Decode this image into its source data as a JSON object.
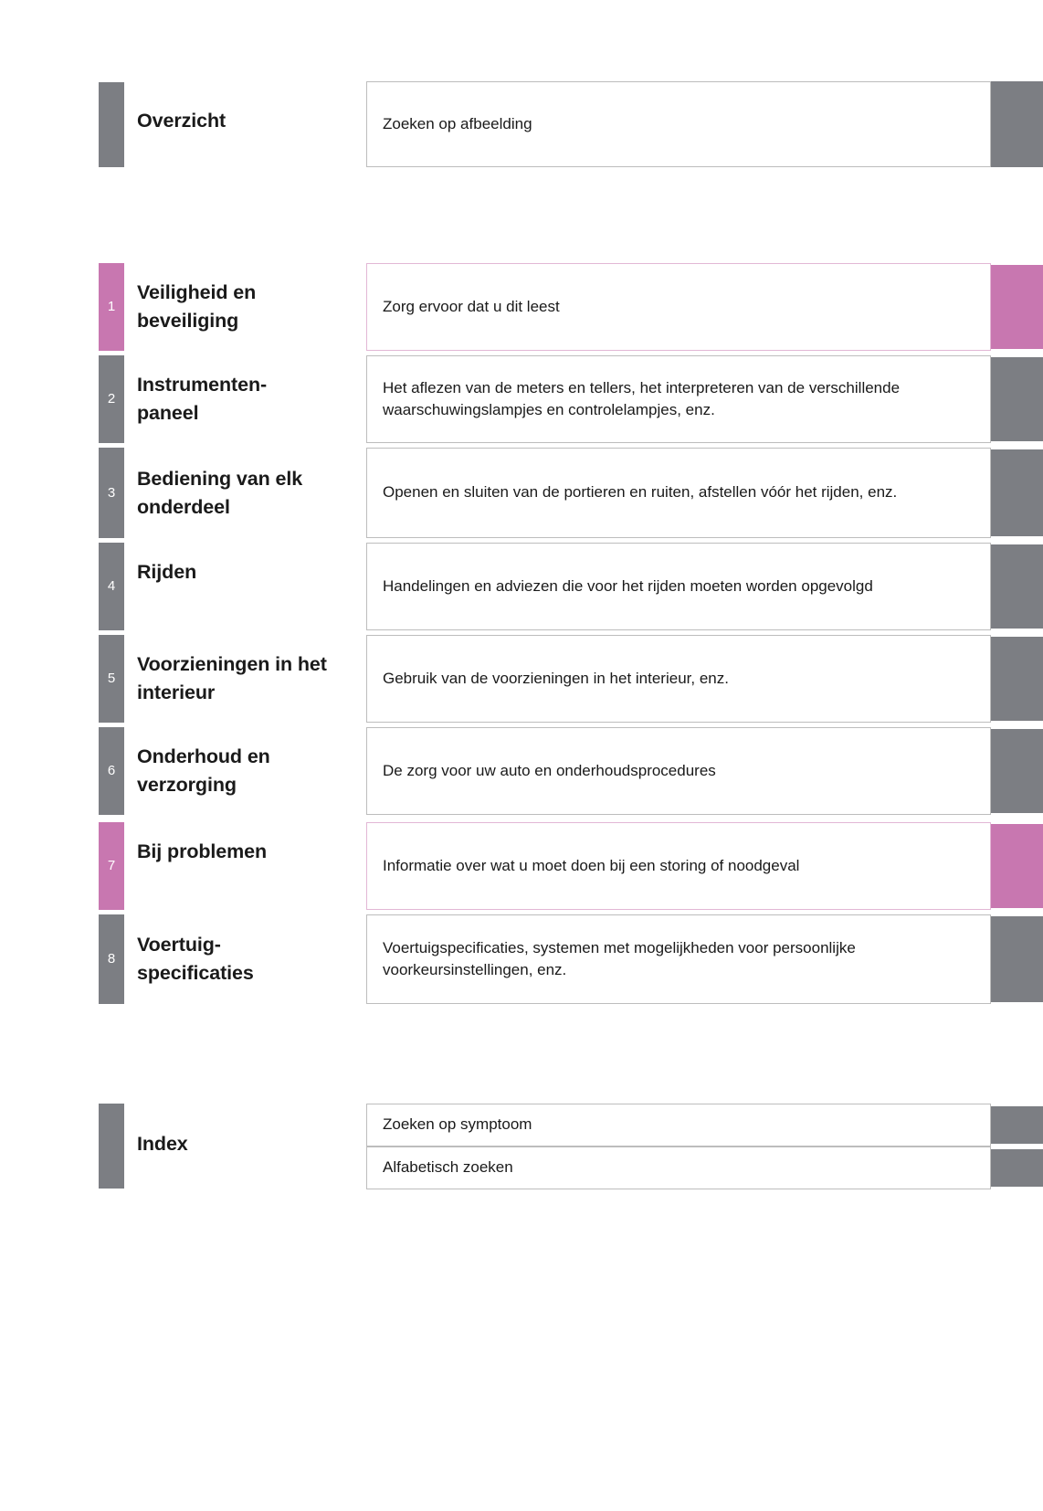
{
  "overview": {
    "title": "Overzicht",
    "description": "Zoeken op afbeelding",
    "accent": "#7c7e83"
  },
  "chapters": [
    {
      "number": "1",
      "title": "Veiligheid en beveiliging",
      "description": "Zorg ervoor dat u dit leest",
      "accent": "#c877b0",
      "highlight": true
    },
    {
      "number": "2",
      "title": "Instrumenten-paneel",
      "description": "Het aflezen van de meters en tellers, het interpreteren van de verschillende waarschuwingslampjes en controlelampjes, enz.",
      "accent": "#7c7e83",
      "highlight": false
    },
    {
      "number": "3",
      "title": "Bediening van elk onderdeel",
      "description": "Openen en sluiten van de portieren en ruiten, afstellen vóór het rijden, enz.",
      "accent": "#7c7e83",
      "highlight": false
    },
    {
      "number": "4",
      "title": "Rijden",
      "description": "Handelingen en adviezen die voor het rijden moeten worden opgevolgd",
      "accent": "#7c7e83",
      "highlight": false
    },
    {
      "number": "5",
      "title": "Voorzieningen in het interieur",
      "description": "Gebruik van de voorzieningen in het interieur, enz.",
      "accent": "#7c7e83",
      "highlight": false
    },
    {
      "number": "6",
      "title": "Onderhoud en verzorging",
      "description": "De zorg voor uw auto en onderhoudsprocedures",
      "accent": "#7c7e83",
      "highlight": false
    },
    {
      "number": "7",
      "title": "Bij problemen",
      "description": "Informatie over wat u moet doen bij een storing of noodgeval",
      "accent": "#c877b0",
      "highlight": true
    },
    {
      "number": "8",
      "title": "Voertuig-specificaties",
      "description": "Voertuigspecificaties, systemen met mogelijkheden voor persoonlijke voorkeursinstellingen, enz.",
      "accent": "#7c7e83",
      "highlight": false
    }
  ],
  "index": {
    "title": "Index",
    "accent": "#7c7e83",
    "entries": [
      {
        "label": "Zoeken op symptoom"
      },
      {
        "label": "Alfabetisch zoeken"
      }
    ]
  }
}
